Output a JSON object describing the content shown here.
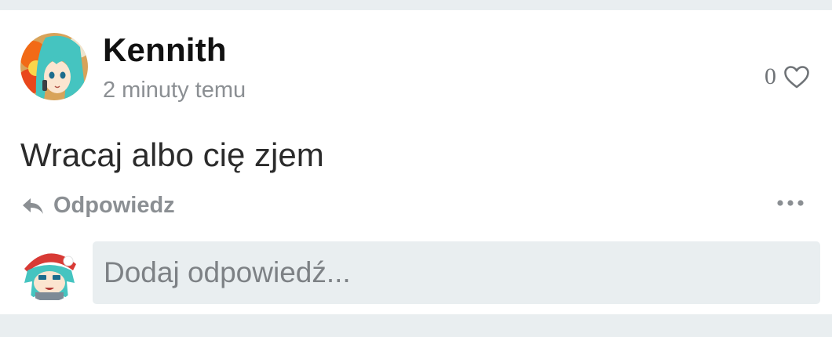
{
  "comment": {
    "author": "Kennith",
    "timestamp": "2 minuty temu",
    "text": "Wracaj albo cię zjem",
    "like_count": "0",
    "reply_label": "Odpowiedz",
    "icons": {
      "like": "heart-outline-icon",
      "reply": "reply-arrow-icon",
      "more": "more-horizontal-icon"
    }
  },
  "reply_box": {
    "placeholder": "Dodaj odpowiedź..."
  },
  "colors": {
    "page_background": "#e9eef0",
    "card_background": "#ffffff",
    "muted_text": "#8b8f93",
    "primary_text": "#111111"
  }
}
